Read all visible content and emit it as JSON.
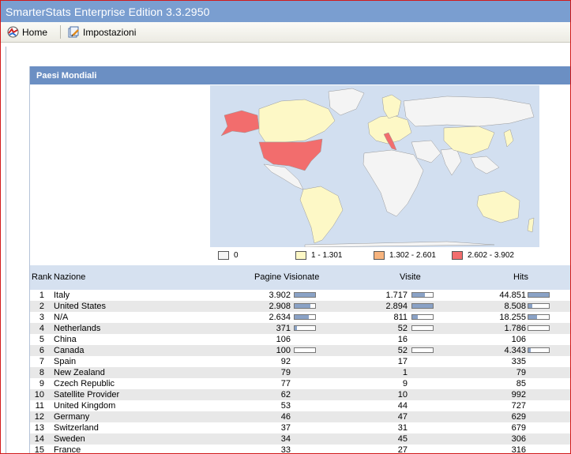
{
  "window": {
    "title": "SmarterStats Enterprise Edition 3.3.2950"
  },
  "toolbar": {
    "home_label": "Home",
    "settings_label": "Impostazioni"
  },
  "panel": {
    "title": "Paesi Mondiali"
  },
  "legend": [
    {
      "label": "0",
      "color": "#f4f4f4"
    },
    {
      "label": "1 - 1.301",
      "color": "#fdf8c6"
    },
    {
      "label": "1.302 - 2.601",
      "color": "#f7b47e"
    },
    {
      "label": "2.602 - 3.902",
      "color": "#f26d6d"
    }
  ],
  "table": {
    "headers": {
      "rank": "Rank",
      "country": "Nazione",
      "pages": "Pagine Visionate",
      "visits": "Visite",
      "hits": "Hits"
    },
    "rows": [
      {
        "rank": "1",
        "country": "Italy",
        "pages": "3.902",
        "visits": "1.717",
        "hits": "44.851",
        "bars": {
          "pages": 1.0,
          "visits": 0.6,
          "hits": 1.0
        }
      },
      {
        "rank": "2",
        "country": "United States",
        "pages": "2.908",
        "visits": "2.894",
        "hits": "8.508",
        "bars": {
          "pages": 0.75,
          "visits": 1.0,
          "hits": 0.19
        }
      },
      {
        "rank": "3",
        "country": "N/A",
        "pages": "2.634",
        "visits": "811",
        "hits": "18.255",
        "bars": {
          "pages": 0.68,
          "visits": 0.28,
          "hits": 0.41
        }
      },
      {
        "rank": "4",
        "country": "Netherlands",
        "pages": "371",
        "visits": "52",
        "hits": "1.786",
        "bars": {
          "pages": 0.1,
          "visits": null,
          "hits": null
        }
      },
      {
        "rank": "5",
        "country": "China",
        "pages": "106",
        "visits": "16",
        "hits": "106"
      },
      {
        "rank": "6",
        "country": "Canada",
        "pages": "100",
        "visits": "52",
        "hits": "4.343",
        "bars": {
          "pages": null,
          "visits": null,
          "hits": 0.1
        }
      },
      {
        "rank": "7",
        "country": "Spain",
        "pages": "92",
        "visits": "17",
        "hits": "335"
      },
      {
        "rank": "8",
        "country": "New Zealand",
        "pages": "79",
        "visits": "1",
        "hits": "79"
      },
      {
        "rank": "9",
        "country": "Czech Republic",
        "pages": "77",
        "visits": "9",
        "hits": "85"
      },
      {
        "rank": "10",
        "country": "Satellite Provider",
        "pages": "62",
        "visits": "10",
        "hits": "992"
      },
      {
        "rank": "11",
        "country": "United Kingdom",
        "pages": "53",
        "visits": "44",
        "hits": "727"
      },
      {
        "rank": "12",
        "country": "Germany",
        "pages": "46",
        "visits": "47",
        "hits": "629"
      },
      {
        "rank": "13",
        "country": "Switzerland",
        "pages": "37",
        "visits": "31",
        "hits": "679"
      },
      {
        "rank": "14",
        "country": "Sweden",
        "pages": "34",
        "visits": "45",
        "hits": "306"
      },
      {
        "rank": "15",
        "country": "France",
        "pages": "33",
        "visits": "27",
        "hits": "316"
      }
    ]
  }
}
